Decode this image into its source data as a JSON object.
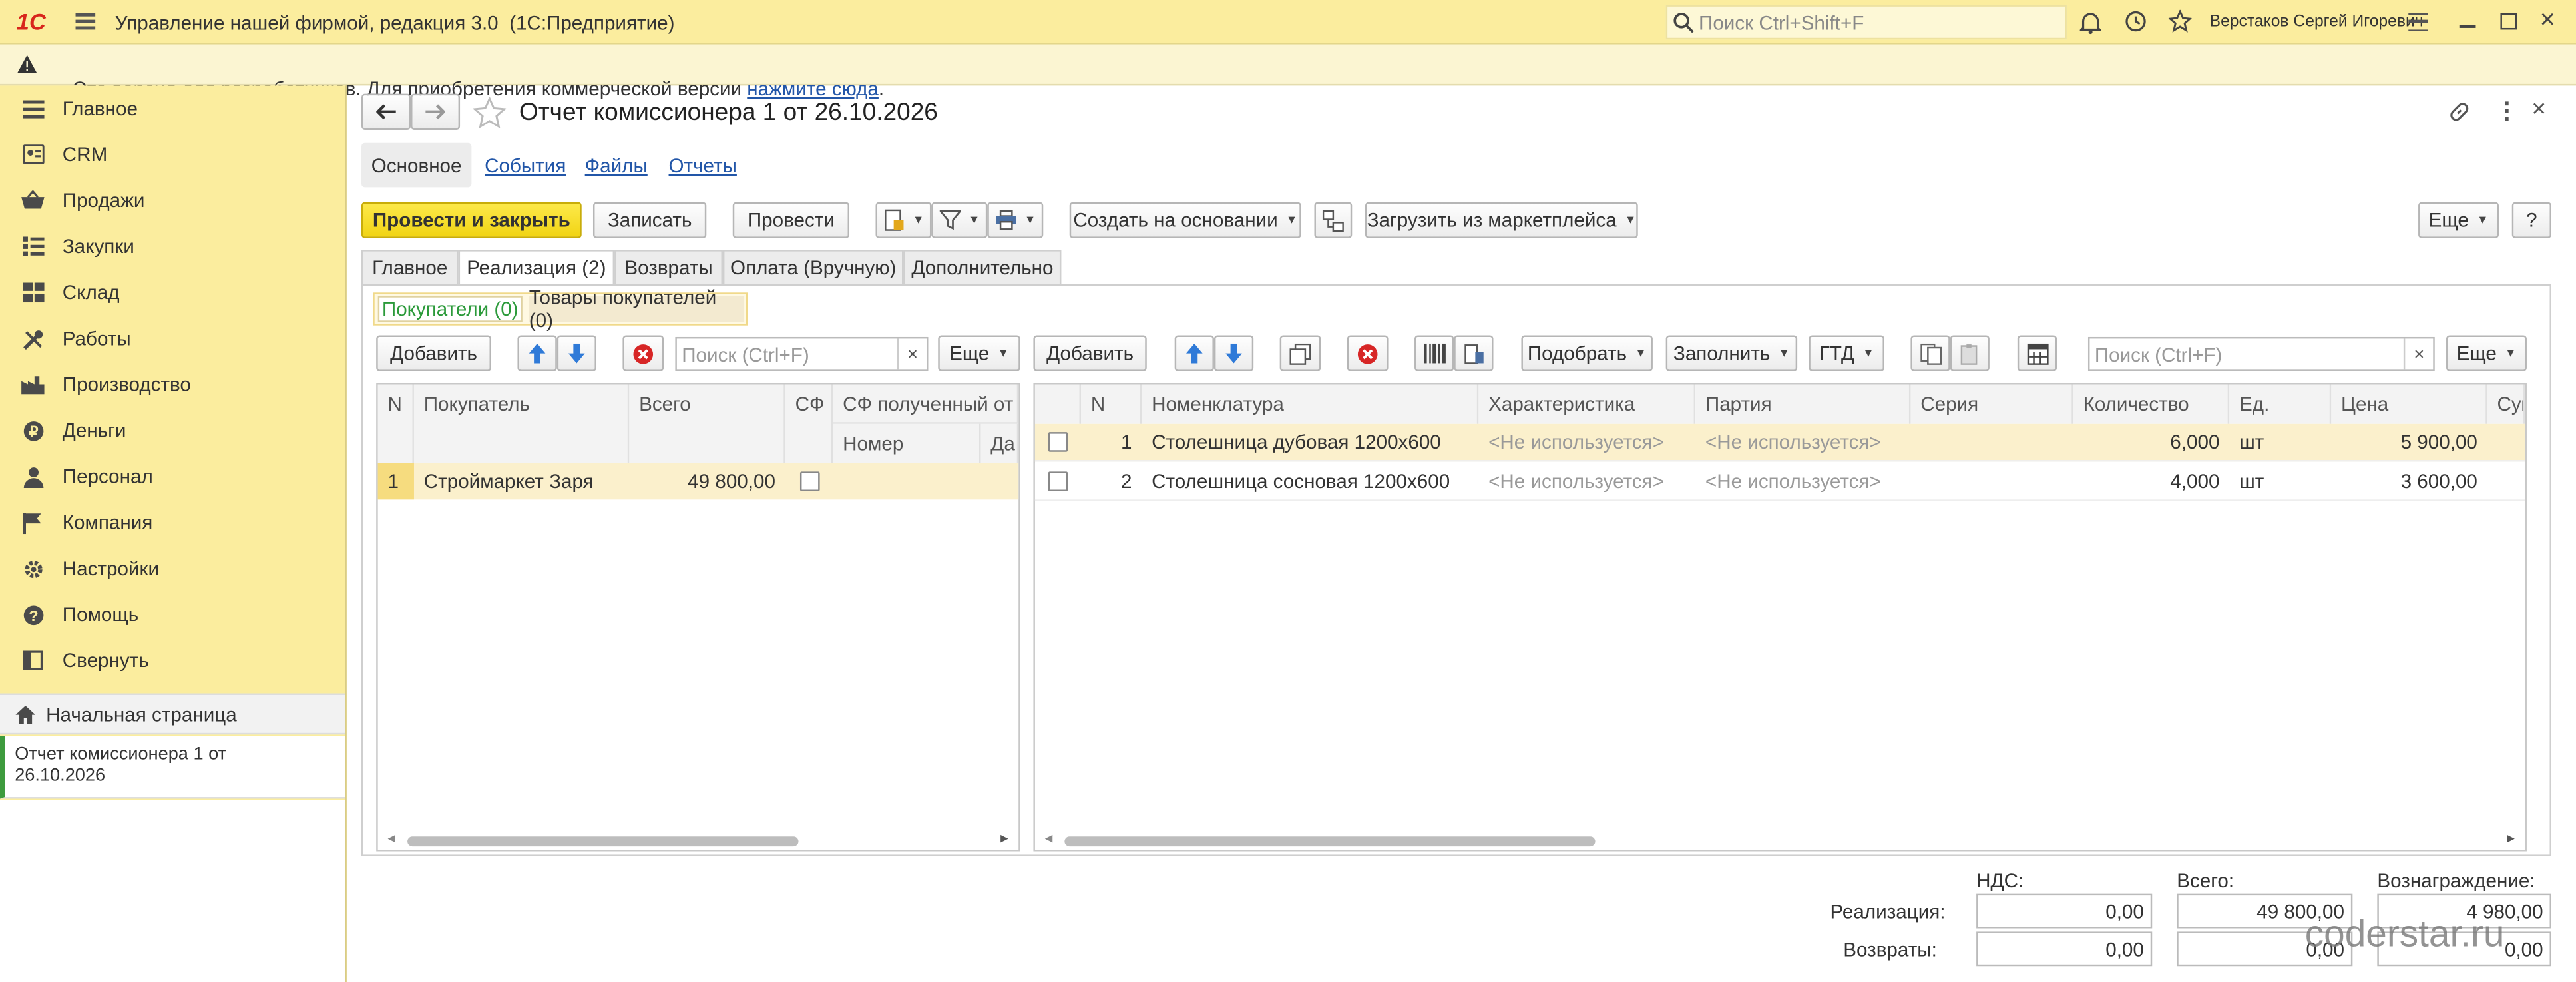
{
  "app": {
    "logo": "1С",
    "title": "Управление нашей фирмой, редакция 3.0  (1С:Предприятие)",
    "search_placeholder": "Поиск Ctrl+Shift+F",
    "user": "Верстаков Сергей Игоревич"
  },
  "warning": {
    "text": "Эта версия для разработчиков. Для приобретения коммерческой версии ",
    "link": "нажмите сюда",
    "tail": "."
  },
  "sidebar": {
    "items": [
      {
        "label": "Главное",
        "icon": "menu-icon"
      },
      {
        "label": "CRM",
        "icon": "crm-icon"
      },
      {
        "label": "Продажи",
        "icon": "basket-icon"
      },
      {
        "label": "Закупки",
        "icon": "list-icon"
      },
      {
        "label": "Склад",
        "icon": "grid-icon"
      },
      {
        "label": "Работы",
        "icon": "tools-icon"
      },
      {
        "label": "Производство",
        "icon": "factory-icon"
      },
      {
        "label": "Деньги",
        "icon": "money-icon"
      },
      {
        "label": "Персонал",
        "icon": "person-icon"
      },
      {
        "label": "Компания",
        "icon": "flag-icon"
      },
      {
        "label": "Настройки",
        "icon": "gear-icon"
      },
      {
        "label": "Помощь",
        "icon": "help-icon"
      },
      {
        "label": "Свернуть",
        "icon": "collapse-icon"
      }
    ],
    "home": "Начальная страница",
    "open_doc": "Отчет комиссионера 1 от 26.10.2026"
  },
  "doc": {
    "title": "Отчет комиссионера 1 от 26.10.2026",
    "nav_tabs": [
      "Основное",
      "События",
      "Файлы",
      "Отчеты"
    ],
    "toolbar": {
      "post_close": "Провести и закрыть",
      "save": "Записать",
      "post": "Провести",
      "create_based": "Создать на основании",
      "load_marketplace": "Загрузить из маркетплейса",
      "more": "Еще",
      "help": "?"
    },
    "tabs": [
      "Главное",
      "Реализация (2)",
      "Возвраты",
      "Оплата (Вручную)",
      "Дополнительно"
    ],
    "subtabs": [
      "Покупатели (0)",
      "Товары покупателей (0)"
    ]
  },
  "left_table": {
    "add": "Добавить",
    "search": "Поиск (Ctrl+F)",
    "more": "Еще",
    "headers": {
      "n": "N",
      "buyer": "Покупатель",
      "total": "Всего",
      "sf": "СФ",
      "sf_recv": "СФ полученный от ко",
      "number": "Номер",
      "date": "Да"
    },
    "rows": [
      {
        "n": "1",
        "buyer": "Строймаркет Заря",
        "total": "49 800,00"
      }
    ]
  },
  "right_table": {
    "add": "Добавить",
    "pick": "Подобрать",
    "fill": "Заполнить",
    "gtd": "ГТД",
    "search": "Поиск (Ctrl+F)",
    "more": "Еще",
    "headers": {
      "n": "N",
      "item": "Номенклатура",
      "char": "Характеристика",
      "batch": "Партия",
      "series": "Серия",
      "qty": "Количество",
      "unit": "Ед.",
      "price": "Цена",
      "sum": "Сум"
    },
    "rows": [
      {
        "n": "1",
        "item": "Столешница дубовая 1200х600",
        "char": "<Не используется>",
        "batch": "<Не используется>",
        "qty": "6,000",
        "unit": "шт",
        "price": "5 900,00"
      },
      {
        "n": "2",
        "item": "Столешница сосновая 1200х600",
        "char": "<Не используется>",
        "batch": "<Не используется>",
        "qty": "4,000",
        "unit": "шт",
        "price": "3 600,00"
      }
    ]
  },
  "totals": {
    "col_vat": "НДС:",
    "col_total": "Всего:",
    "col_reward": "Вознаграждение:",
    "row_sales": "Реализация:",
    "row_returns": "Возвраты:",
    "sales": {
      "vat": "0,00",
      "total": "49 800,00",
      "reward": "4 980,00"
    },
    "returns": {
      "vat": "0,00",
      "total": "0,00",
      "reward": "0,00"
    }
  },
  "watermark": "coderstar.ru"
}
